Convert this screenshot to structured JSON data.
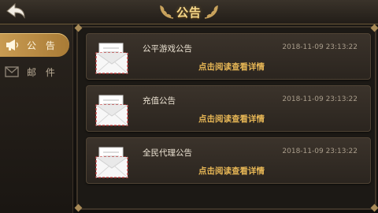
{
  "header": {
    "title": "公告",
    "back_icon": "back-arrow-icon"
  },
  "sidebar": {
    "items": [
      {
        "label": "公 告",
        "icon": "megaphone-icon",
        "active": true
      },
      {
        "label": "邮 件",
        "icon": "mail-icon",
        "active": false
      }
    ]
  },
  "notices": [
    {
      "title": "公平游戏公告",
      "date": "2018-11-09 23:13:22",
      "link": "点击阅读查看详情"
    },
    {
      "title": "充值公告",
      "date": "2018-11-09 23:13:22",
      "link": "点击阅读查看详情"
    },
    {
      "title": "全民代理公告",
      "date": "2018-11-09 23:13:22",
      "link": "点击阅读查看详情"
    }
  ],
  "colors": {
    "accent_gold": "#e5b555",
    "active_tab": "#c89b52",
    "title_gold": "#f6d98b"
  }
}
